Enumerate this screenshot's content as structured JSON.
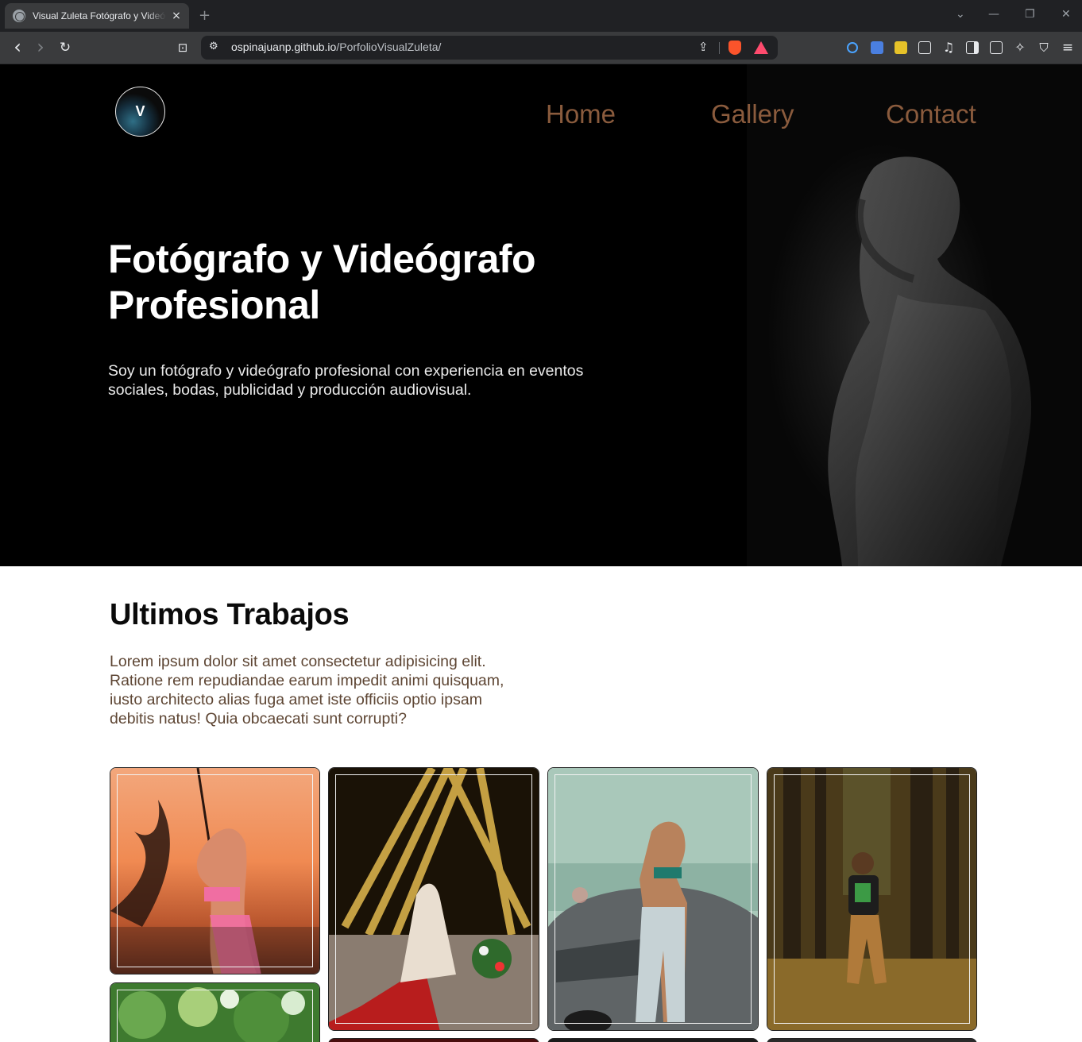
{
  "browser": {
    "tab_title": "Visual Zuleta Fotógrafo y Videógrafo",
    "tab_close": "×",
    "new_tab": "+",
    "url_host": "ospinajuanp.github.io",
    "url_path": "/PorfolioVisualZuleta/",
    "window_controls": {
      "minimize": "—",
      "restore": "❐",
      "close": "✕"
    },
    "toolbar_icons": {
      "back": "‹",
      "forward": "›",
      "reload": "↻",
      "bookmark": "⊡",
      "menu": "≡"
    }
  },
  "site": {
    "logo_letter": "V",
    "nav": [
      {
        "label": "Home"
      },
      {
        "label": "Gallery"
      },
      {
        "label": "Contact"
      }
    ],
    "hero": {
      "title_line1": "Fotógrafo y Videógrafo",
      "title_line2": "Profesional",
      "description": "Soy un fotógrafo y videógrafo profesional con experiencia en eventos sociales, bodas, publicidad y producción audiovisual."
    },
    "works": {
      "title": "Ultimos Trabajos",
      "description": "Lorem ipsum dolor sit amet consectetur adipisicing elit. Ratione rem repudiandae earum impedit animi quisquam, iusto architecto alias fuga amet iste officiis optio ipsam debitis natus! Quia obcaecati sunt corrupti?"
    }
  },
  "colors": {
    "nav_link": "#8a5b3d",
    "hero_bg": "#000000",
    "section_text": "#5e4634",
    "brave_orange": "#fb542b"
  }
}
